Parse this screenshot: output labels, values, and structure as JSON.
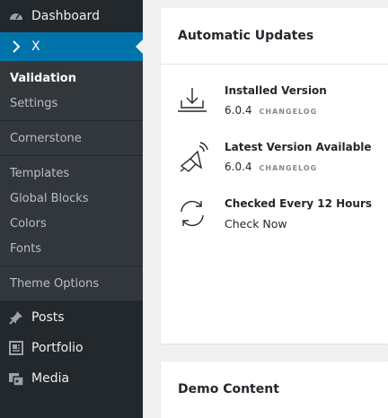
{
  "sidebar": {
    "dashboard": "Dashboard",
    "current": "X",
    "submenu": [
      {
        "label": "Validation",
        "active": true
      },
      {
        "label": "Settings"
      },
      {
        "label": "Cornerstone"
      },
      {
        "label": "Templates"
      },
      {
        "label": "Global Blocks"
      },
      {
        "label": "Colors"
      },
      {
        "label": "Fonts"
      },
      {
        "label": "Theme Options"
      }
    ],
    "lower": [
      {
        "label": "Posts",
        "icon": "pin-icon"
      },
      {
        "label": "Portfolio",
        "icon": "portfolio-icon"
      },
      {
        "label": "Media",
        "icon": "media-icon"
      }
    ]
  },
  "updates_card": {
    "title": "Automatic Updates",
    "installed": {
      "label": "Installed Version",
      "value": "6.0.4",
      "link": "CHANGELOG"
    },
    "latest": {
      "label": "Latest Version Available",
      "value": "6.0.4",
      "link": "CHANGELOG"
    },
    "checked": {
      "label": "Checked Every 12 Hours",
      "link": "Check Now"
    }
  },
  "demo_card": {
    "title": "Demo Content"
  },
  "colors": {
    "sidebar": "#23282d",
    "submenu": "#32373c",
    "accent": "#0073aa",
    "page": "#f0f0f1"
  }
}
